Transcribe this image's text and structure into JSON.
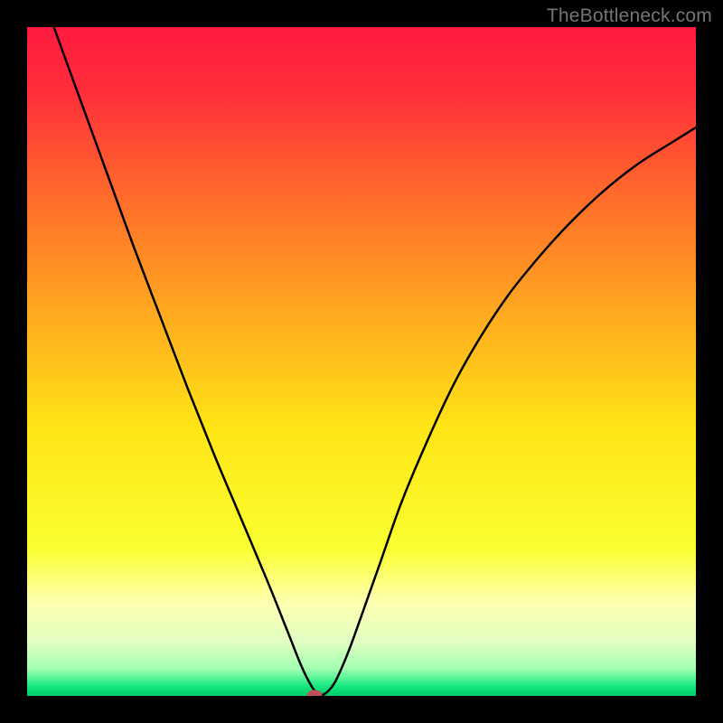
{
  "watermark": "TheBottleneck.com",
  "chart_data": {
    "type": "line",
    "title": "",
    "xlabel": "",
    "ylabel": "",
    "xlim": [
      0,
      100
    ],
    "ylim": [
      0,
      100
    ],
    "grid": false,
    "legend": false,
    "background_gradient_stops": [
      {
        "pos": 0.0,
        "color": "#ff1a3e"
      },
      {
        "pos": 0.1,
        "color": "#ff2f3a"
      },
      {
        "pos": 0.25,
        "color": "#ff6a2b"
      },
      {
        "pos": 0.45,
        "color": "#ffb11e"
      },
      {
        "pos": 0.6,
        "color": "#ffe516"
      },
      {
        "pos": 0.78,
        "color": "#faff30"
      },
      {
        "pos": 0.86,
        "color": "#ffffb0"
      },
      {
        "pos": 0.92,
        "color": "#e0ffc2"
      },
      {
        "pos": 0.96,
        "color": "#a0ffb0"
      },
      {
        "pos": 0.985,
        "color": "#18e880"
      },
      {
        "pos": 1.0,
        "color": "#00cc66"
      }
    ],
    "series": [
      {
        "name": "bottleneck-curve",
        "minimum_x": 43,
        "points": [
          {
            "x": 4.0,
            "y": 100.0
          },
          {
            "x": 8.0,
            "y": 89.0
          },
          {
            "x": 12.0,
            "y": 78.0
          },
          {
            "x": 16.0,
            "y": 67.0
          },
          {
            "x": 20.0,
            "y": 56.5
          },
          {
            "x": 24.0,
            "y": 46.0
          },
          {
            "x": 28.0,
            "y": 36.0
          },
          {
            "x": 32.0,
            "y": 26.5
          },
          {
            "x": 36.0,
            "y": 17.0
          },
          {
            "x": 39.0,
            "y": 9.5
          },
          {
            "x": 41.0,
            "y": 4.5
          },
          {
            "x": 42.5,
            "y": 1.5
          },
          {
            "x": 43.5,
            "y": 0.3
          },
          {
            "x": 44.5,
            "y": 0.3
          },
          {
            "x": 46.0,
            "y": 2.0
          },
          {
            "x": 48.0,
            "y": 6.5
          },
          {
            "x": 50.0,
            "y": 12.0
          },
          {
            "x": 53.0,
            "y": 20.5
          },
          {
            "x": 56.0,
            "y": 29.0
          },
          {
            "x": 60.0,
            "y": 38.5
          },
          {
            "x": 64.0,
            "y": 47.0
          },
          {
            "x": 68.0,
            "y": 54.0
          },
          {
            "x": 72.0,
            "y": 60.0
          },
          {
            "x": 76.0,
            "y": 65.0
          },
          {
            "x": 80.0,
            "y": 69.5
          },
          {
            "x": 84.0,
            "y": 73.5
          },
          {
            "x": 88.0,
            "y": 77.0
          },
          {
            "x": 92.0,
            "y": 80.0
          },
          {
            "x": 96.0,
            "y": 82.5
          },
          {
            "x": 100.0,
            "y": 85.0
          }
        ]
      }
    ],
    "marker": {
      "name": "optimal-marker",
      "x": 43.0,
      "y": 0.2,
      "rx_pct": 1.1,
      "ry_pct": 0.7,
      "fill": "#c05058"
    }
  }
}
